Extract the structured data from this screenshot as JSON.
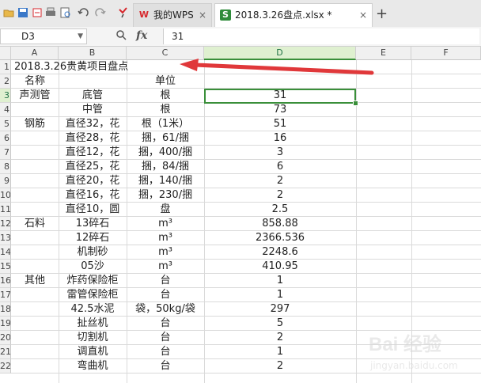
{
  "toolbar": {
    "icons": [
      "open-folder-icon",
      "save-icon",
      "undo-arrow-icon",
      "print-icon",
      "print-preview-icon",
      "undo-icon",
      "redo-icon",
      "format-painter-icon"
    ]
  },
  "tabs": [
    {
      "label": "我的WPS",
      "icon": "W",
      "icon_color": "#d7262b",
      "close": "×"
    },
    {
      "label": "2018.3.26盘点.xlsx *",
      "icon": "S",
      "icon_color": "#2e8b3a",
      "close": "×"
    }
  ],
  "formula_bar": {
    "cell_ref": "D3",
    "fx": "fx",
    "value": "31"
  },
  "columns": [
    "A",
    "B",
    "C",
    "D",
    "E",
    "F"
  ],
  "rows": [
    {
      "n": "1",
      "a": "",
      "b": "",
      "c": "",
      "d": ""
    },
    {
      "n": "2",
      "a": "名称",
      "b": "",
      "c": "单位",
      "d": ""
    },
    {
      "n": "3",
      "a": "声测管",
      "b": "底管",
      "c": "根",
      "d": "31"
    },
    {
      "n": "4",
      "a": "",
      "b": "中管",
      "c": "根",
      "d": "73"
    },
    {
      "n": "5",
      "a": "钢筋",
      "b": "直径32，花",
      "c": "根（1米）",
      "d": "51"
    },
    {
      "n": "6",
      "a": "",
      "b": "直径28，花",
      "c": "捆，61/捆",
      "d": "16"
    },
    {
      "n": "7",
      "a": "",
      "b": "直径12，花",
      "c": "捆，400/捆",
      "d": "3"
    },
    {
      "n": "8",
      "a": "",
      "b": "直径25，花",
      "c": "捆，84/捆",
      "d": "6"
    },
    {
      "n": "9",
      "a": "",
      "b": "直径20，花",
      "c": "捆，140/捆",
      "d": "2"
    },
    {
      "n": "10",
      "a": "",
      "b": "直径16，花",
      "c": "捆，230/捆",
      "d": "2"
    },
    {
      "n": "11",
      "a": "",
      "b": "直径10，圆",
      "c": "盘",
      "d": "2.5"
    },
    {
      "n": "12",
      "a": "石料",
      "b": "13碎石",
      "c": "m³",
      "d": "858.88"
    },
    {
      "n": "13",
      "a": "",
      "b": "12碎石",
      "c": "m³",
      "d": "2366.536"
    },
    {
      "n": "14",
      "a": "",
      "b": "机制砂",
      "c": "m³",
      "d": "2248.6"
    },
    {
      "n": "15",
      "a": "",
      "b": "05沙",
      "c": "m³",
      "d": "410.95"
    },
    {
      "n": "16",
      "a": "其他",
      "b": "炸药保险柜",
      "c": "台",
      "d": "1"
    },
    {
      "n": "17",
      "a": "",
      "b": "雷管保险柜",
      "c": "台",
      "d": "1"
    },
    {
      "n": "18",
      "a": "",
      "b": "42.5水泥",
      "c": "袋，50kg/袋",
      "d": "297"
    },
    {
      "n": "19",
      "a": "",
      "b": "扯丝机",
      "c": "台",
      "d": "5"
    },
    {
      "n": "20",
      "a": "",
      "b": "切割机",
      "c": "台",
      "d": "2"
    },
    {
      "n": "21",
      "a": "",
      "b": "调直机",
      "c": "台",
      "d": "1"
    },
    {
      "n": "22",
      "a": "",
      "b": "弯曲机",
      "c": "台",
      "d": "2"
    }
  ],
  "title_cell": "2018.3.26贵黄项目盘点",
  "annotation": {
    "arrow_color": "#e0383a"
  },
  "watermark": {
    "logo": "Bai 经验",
    "caption": "jingyan.baidu.com"
  }
}
